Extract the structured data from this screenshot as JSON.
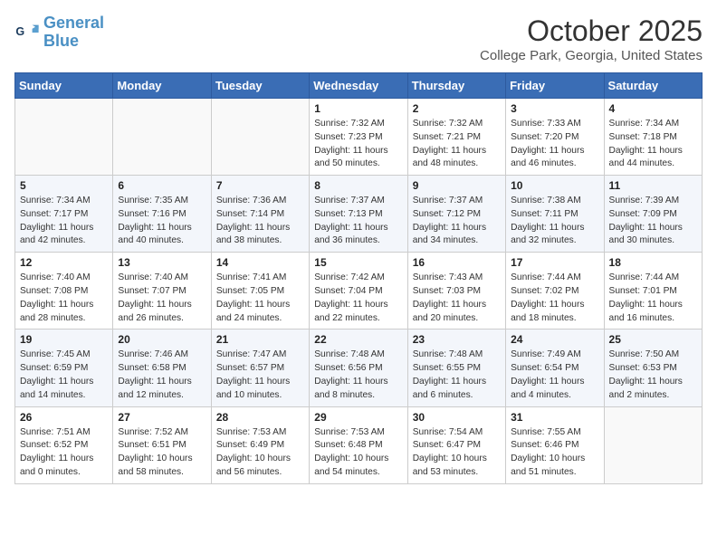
{
  "header": {
    "logo_line1": "General",
    "logo_line2": "Blue",
    "title": "October 2025",
    "subtitle": "College Park, Georgia, United States"
  },
  "days_of_week": [
    "Sunday",
    "Monday",
    "Tuesday",
    "Wednesday",
    "Thursday",
    "Friday",
    "Saturday"
  ],
  "weeks": [
    [
      {
        "day": "",
        "sunrise": "",
        "sunset": "",
        "daylight": ""
      },
      {
        "day": "",
        "sunrise": "",
        "sunset": "",
        "daylight": ""
      },
      {
        "day": "",
        "sunrise": "",
        "sunset": "",
        "daylight": ""
      },
      {
        "day": "1",
        "sunrise": "Sunrise: 7:32 AM",
        "sunset": "Sunset: 7:23 PM",
        "daylight": "Daylight: 11 hours and 50 minutes."
      },
      {
        "day": "2",
        "sunrise": "Sunrise: 7:32 AM",
        "sunset": "Sunset: 7:21 PM",
        "daylight": "Daylight: 11 hours and 48 minutes."
      },
      {
        "day": "3",
        "sunrise": "Sunrise: 7:33 AM",
        "sunset": "Sunset: 7:20 PM",
        "daylight": "Daylight: 11 hours and 46 minutes."
      },
      {
        "day": "4",
        "sunrise": "Sunrise: 7:34 AM",
        "sunset": "Sunset: 7:18 PM",
        "daylight": "Daylight: 11 hours and 44 minutes."
      }
    ],
    [
      {
        "day": "5",
        "sunrise": "Sunrise: 7:34 AM",
        "sunset": "Sunset: 7:17 PM",
        "daylight": "Daylight: 11 hours and 42 minutes."
      },
      {
        "day": "6",
        "sunrise": "Sunrise: 7:35 AM",
        "sunset": "Sunset: 7:16 PM",
        "daylight": "Daylight: 11 hours and 40 minutes."
      },
      {
        "day": "7",
        "sunrise": "Sunrise: 7:36 AM",
        "sunset": "Sunset: 7:14 PM",
        "daylight": "Daylight: 11 hours and 38 minutes."
      },
      {
        "day": "8",
        "sunrise": "Sunrise: 7:37 AM",
        "sunset": "Sunset: 7:13 PM",
        "daylight": "Daylight: 11 hours and 36 minutes."
      },
      {
        "day": "9",
        "sunrise": "Sunrise: 7:37 AM",
        "sunset": "Sunset: 7:12 PM",
        "daylight": "Daylight: 11 hours and 34 minutes."
      },
      {
        "day": "10",
        "sunrise": "Sunrise: 7:38 AM",
        "sunset": "Sunset: 7:11 PM",
        "daylight": "Daylight: 11 hours and 32 minutes."
      },
      {
        "day": "11",
        "sunrise": "Sunrise: 7:39 AM",
        "sunset": "Sunset: 7:09 PM",
        "daylight": "Daylight: 11 hours and 30 minutes."
      }
    ],
    [
      {
        "day": "12",
        "sunrise": "Sunrise: 7:40 AM",
        "sunset": "Sunset: 7:08 PM",
        "daylight": "Daylight: 11 hours and 28 minutes."
      },
      {
        "day": "13",
        "sunrise": "Sunrise: 7:40 AM",
        "sunset": "Sunset: 7:07 PM",
        "daylight": "Daylight: 11 hours and 26 minutes."
      },
      {
        "day": "14",
        "sunrise": "Sunrise: 7:41 AM",
        "sunset": "Sunset: 7:05 PM",
        "daylight": "Daylight: 11 hours and 24 minutes."
      },
      {
        "day": "15",
        "sunrise": "Sunrise: 7:42 AM",
        "sunset": "Sunset: 7:04 PM",
        "daylight": "Daylight: 11 hours and 22 minutes."
      },
      {
        "day": "16",
        "sunrise": "Sunrise: 7:43 AM",
        "sunset": "Sunset: 7:03 PM",
        "daylight": "Daylight: 11 hours and 20 minutes."
      },
      {
        "day": "17",
        "sunrise": "Sunrise: 7:44 AM",
        "sunset": "Sunset: 7:02 PM",
        "daylight": "Daylight: 11 hours and 18 minutes."
      },
      {
        "day": "18",
        "sunrise": "Sunrise: 7:44 AM",
        "sunset": "Sunset: 7:01 PM",
        "daylight": "Daylight: 11 hours and 16 minutes."
      }
    ],
    [
      {
        "day": "19",
        "sunrise": "Sunrise: 7:45 AM",
        "sunset": "Sunset: 6:59 PM",
        "daylight": "Daylight: 11 hours and 14 minutes."
      },
      {
        "day": "20",
        "sunrise": "Sunrise: 7:46 AM",
        "sunset": "Sunset: 6:58 PM",
        "daylight": "Daylight: 11 hours and 12 minutes."
      },
      {
        "day": "21",
        "sunrise": "Sunrise: 7:47 AM",
        "sunset": "Sunset: 6:57 PM",
        "daylight": "Daylight: 11 hours and 10 minutes."
      },
      {
        "day": "22",
        "sunrise": "Sunrise: 7:48 AM",
        "sunset": "Sunset: 6:56 PM",
        "daylight": "Daylight: 11 hours and 8 minutes."
      },
      {
        "day": "23",
        "sunrise": "Sunrise: 7:48 AM",
        "sunset": "Sunset: 6:55 PM",
        "daylight": "Daylight: 11 hours and 6 minutes."
      },
      {
        "day": "24",
        "sunrise": "Sunrise: 7:49 AM",
        "sunset": "Sunset: 6:54 PM",
        "daylight": "Daylight: 11 hours and 4 minutes."
      },
      {
        "day": "25",
        "sunrise": "Sunrise: 7:50 AM",
        "sunset": "Sunset: 6:53 PM",
        "daylight": "Daylight: 11 hours and 2 minutes."
      }
    ],
    [
      {
        "day": "26",
        "sunrise": "Sunrise: 7:51 AM",
        "sunset": "Sunset: 6:52 PM",
        "daylight": "Daylight: 11 hours and 0 minutes."
      },
      {
        "day": "27",
        "sunrise": "Sunrise: 7:52 AM",
        "sunset": "Sunset: 6:51 PM",
        "daylight": "Daylight: 10 hours and 58 minutes."
      },
      {
        "day": "28",
        "sunrise": "Sunrise: 7:53 AM",
        "sunset": "Sunset: 6:49 PM",
        "daylight": "Daylight: 10 hours and 56 minutes."
      },
      {
        "day": "29",
        "sunrise": "Sunrise: 7:53 AM",
        "sunset": "Sunset: 6:48 PM",
        "daylight": "Daylight: 10 hours and 54 minutes."
      },
      {
        "day": "30",
        "sunrise": "Sunrise: 7:54 AM",
        "sunset": "Sunset: 6:47 PM",
        "daylight": "Daylight: 10 hours and 53 minutes."
      },
      {
        "day": "31",
        "sunrise": "Sunrise: 7:55 AM",
        "sunset": "Sunset: 6:46 PM",
        "daylight": "Daylight: 10 hours and 51 minutes."
      },
      {
        "day": "",
        "sunrise": "",
        "sunset": "",
        "daylight": ""
      }
    ]
  ]
}
